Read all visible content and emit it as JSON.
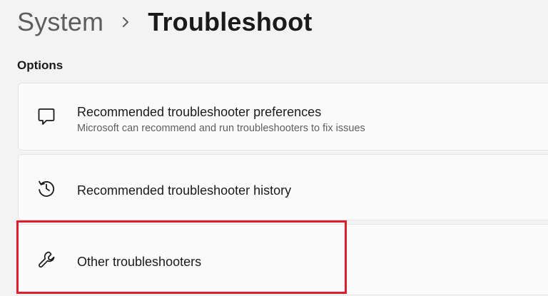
{
  "breadcrumb": {
    "parent": "System",
    "separator_icon": "chevron-right-icon",
    "current": "Troubleshoot"
  },
  "section": {
    "label": "Options"
  },
  "options": [
    {
      "title": "Recommended troubleshooter preferences",
      "description": "Microsoft can recommend and run troubleshooters to fix issues",
      "icon": "chat-bubble-icon"
    },
    {
      "title": "Recommended troubleshooter history",
      "icon": "history-icon"
    },
    {
      "title": "Other troubleshooters",
      "icon": "wrench-icon",
      "highlighted": true
    }
  ],
  "colors": {
    "highlight": "#e01b2c",
    "background": "#f3f3f3",
    "card": "#fbfbfb"
  }
}
